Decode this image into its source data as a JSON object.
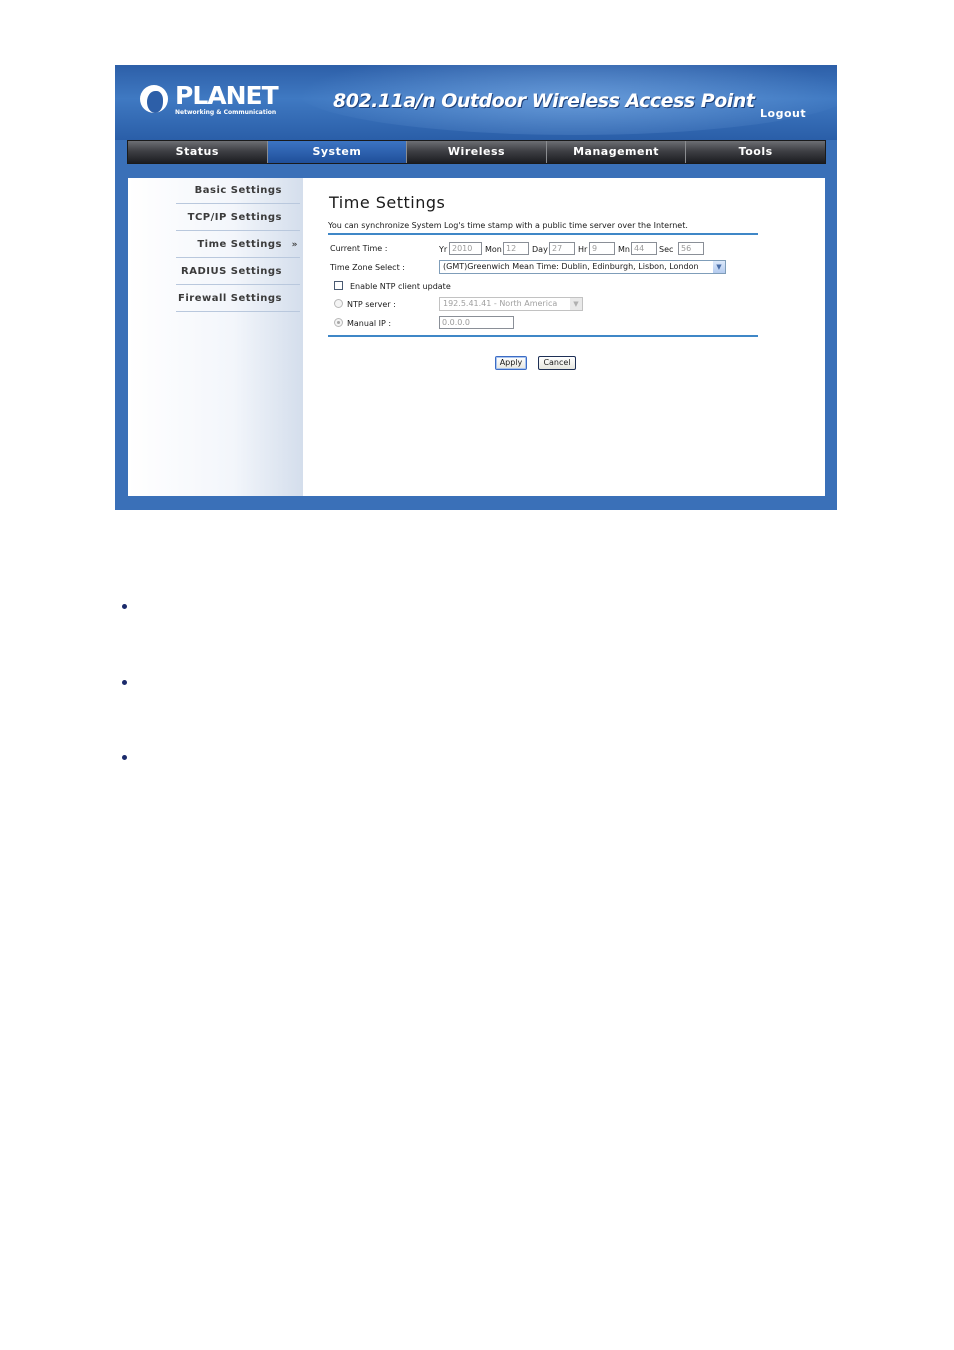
{
  "header": {
    "brand": "PLANET",
    "brand_tagline": "Networking & Communication",
    "product_title": "802.11a/n Outdoor Wireless Access Point",
    "logout_label": "Logout"
  },
  "nav": {
    "tabs": [
      {
        "label": "Status",
        "active": false
      },
      {
        "label": "System",
        "active": true
      },
      {
        "label": "Wireless",
        "active": false
      },
      {
        "label": "Management",
        "active": false
      },
      {
        "label": "Tools",
        "active": false
      }
    ]
  },
  "sidebar": {
    "items": [
      {
        "label": "Basic Settings",
        "active": false
      },
      {
        "label": "TCP/IP Settings",
        "active": false
      },
      {
        "label": "Time Settings",
        "active": true
      },
      {
        "label": "RADIUS Settings",
        "active": false
      },
      {
        "label": "Firewall Settings",
        "active": false
      }
    ],
    "active_marker": "»"
  },
  "main": {
    "title": "Time Settings",
    "description": "You can synchronize System Log's time stamp with a public time server over the Internet.",
    "current_time": {
      "label": "Current Time :",
      "yr_label": "Yr",
      "yr": "2010",
      "mon_label": "Mon",
      "mon": "12",
      "day_label": "Day",
      "day": "27",
      "hr_label": "Hr",
      "hr": "9",
      "mn_label": "Mn",
      "mn": "44",
      "sec_label": "Sec",
      "sec": "56"
    },
    "timezone": {
      "label": "Time Zone Select :",
      "selected": "(GMT)Greenwich Mean Time: Dublin, Edinburgh, Lisbon, London"
    },
    "ntp_enable": {
      "label": "Enable NTP client update",
      "checked": false
    },
    "ntp_server": {
      "label": "NTP server :",
      "selected": "192.5.41.41 - North America",
      "disabled": true
    },
    "manual_ip": {
      "label": "Manual IP :",
      "value": "0.0.0.0",
      "disabled": true,
      "selected": true
    },
    "buttons": {
      "apply": "Apply",
      "cancel": "Cancel"
    }
  },
  "colors": {
    "frame_blue": "#3a70b8",
    "nav_active": "#2d63b3",
    "nav_dark": "#2b2c31",
    "rule_blue": "#3f87c7",
    "bullet": "#1b2a6b"
  },
  "document_bullets": 3
}
